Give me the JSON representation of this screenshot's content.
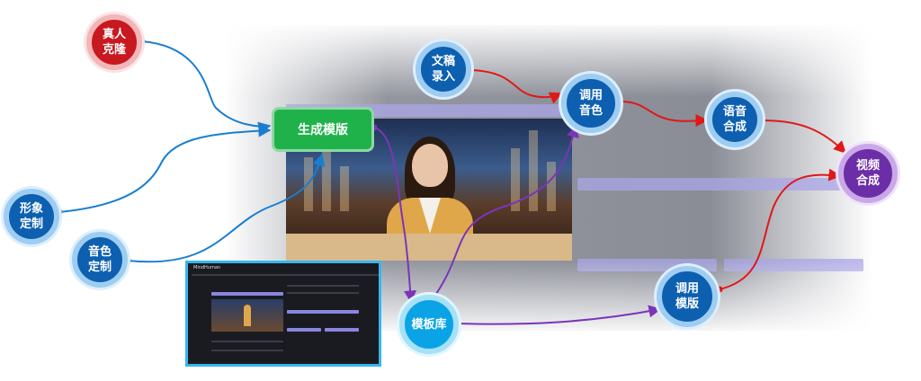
{
  "nodes": {
    "real_person_clone": "真人\n克隆",
    "image_custom": "形象\n定制",
    "voice_custom": "音色\n定制",
    "generate_template": "生成模版",
    "script_input": "文稿\n录入",
    "adjust_voice": "调用\n音色",
    "speech_synthesis": "语音\n合成",
    "video_synthesis": "视频\n合成",
    "template_library": "模板库",
    "invoke_template": "调用\n模版"
  },
  "thumbnail": {
    "title": "MindHuman"
  },
  "colors": {
    "blue_link": "#1a7ed0",
    "red_link": "#e01818",
    "purple_link": "#7b35b8"
  }
}
